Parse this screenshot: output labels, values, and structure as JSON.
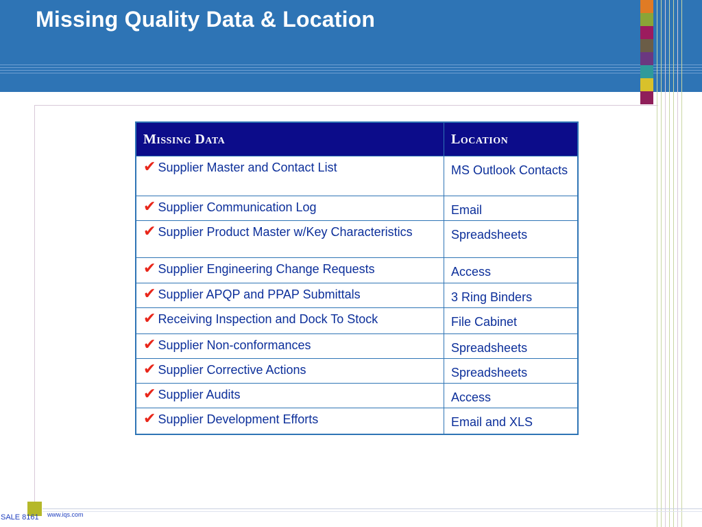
{
  "slide": {
    "title": "Missing Quality Data & Location",
    "footer_code": "SALE 8161",
    "footer_url": "www.iqs.com"
  },
  "swatch_colors": [
    "#e07b24",
    "#8aa537",
    "#9c1b5e",
    "#6b5d47",
    "#6b3880",
    "#2f9a9a",
    "#d8c12b",
    "#8f1f5a"
  ],
  "table": {
    "headers": [
      "Missing Data",
      "Location"
    ],
    "check_icon": "✔",
    "rows": [
      {
        "item": "Supplier Master and Contact List",
        "location": "MS Outlook Contacts"
      },
      {
        "item": "Supplier Communication Log",
        "location": "Email"
      },
      {
        "item": "Supplier Product Master w/Key Characteristics",
        "location": "Spreadsheets"
      },
      {
        "item": "Supplier Engineering Change Requests",
        "location": "Access"
      },
      {
        "item": "Supplier APQP and PPAP Submittals",
        "location": "3 Ring Binders"
      },
      {
        "item": "Receiving Inspection and Dock To Stock",
        "location": "File Cabinet"
      },
      {
        "item": "Supplier Non-conformances",
        "location": "Spreadsheets"
      },
      {
        "item": "Supplier Corrective Actions",
        "location": "Spreadsheets"
      },
      {
        "item": "Supplier Audits",
        "location": "Access"
      },
      {
        "item": "Supplier Development Efforts",
        "location": "Email and XLS"
      }
    ]
  }
}
